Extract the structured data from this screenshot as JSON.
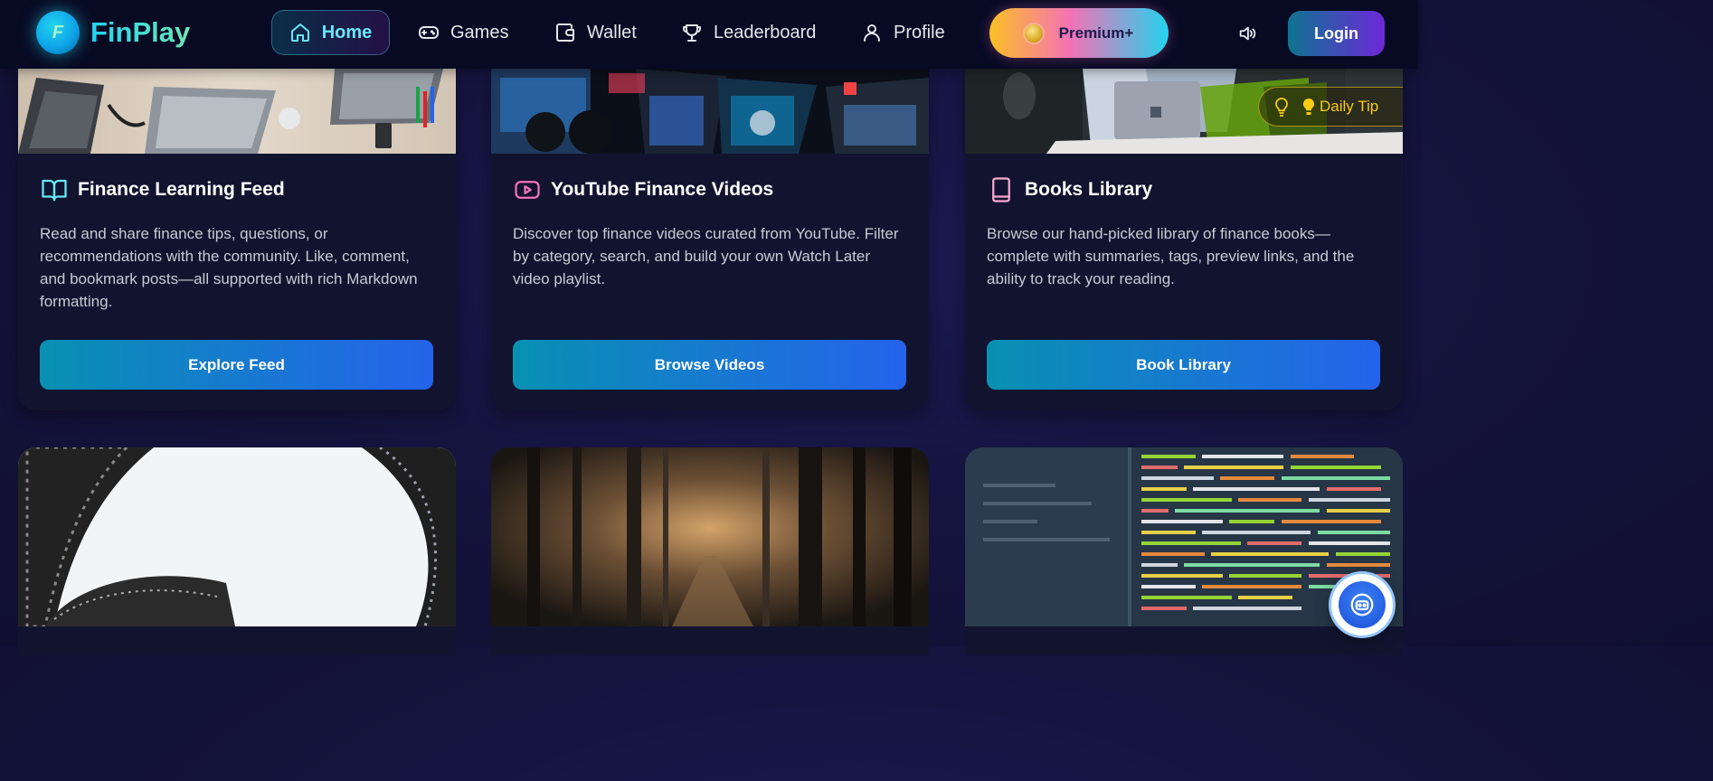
{
  "brand": {
    "name": "FinPlay",
    "logo_letter": "F"
  },
  "nav": {
    "items": [
      {
        "label": "Home",
        "icon": "home-icon",
        "active": true
      },
      {
        "label": "Games",
        "icon": "gamepad-icon"
      },
      {
        "label": "Wallet",
        "icon": "wallet-icon"
      },
      {
        "label": "Leaderboard",
        "icon": "trophy-icon"
      },
      {
        "label": "Profile",
        "icon": "user-icon"
      }
    ],
    "premium_label": "Premium+",
    "login_label": "Login",
    "sound_icon": "speaker-icon"
  },
  "daily_tip": {
    "label": "Daily Tip",
    "icon": "lightbulb-icon"
  },
  "cards": [
    {
      "title": "Finance Learning Feed",
      "icon": "open-book-icon",
      "description": "Read and share finance tips, questions, or recommendations with the community. Like, comment, and bookmark posts—all supported with rich Markdown formatting.",
      "button": "Explore Feed"
    },
    {
      "title": "YouTube Finance Videos",
      "icon": "video-play-icon",
      "description": "Discover top finance videos curated from YouTube. Filter by category, search, and build your own Watch Later video playlist.",
      "button": "Browse Videos"
    },
    {
      "title": "Books Library",
      "icon": "book-icon",
      "description": "Browse our hand-picked library of finance books—complete with summaries, tags, preview links, and the ability to track your reading.",
      "button": "Book Library"
    }
  ],
  "colors": {
    "accent_cyan": "#67e8f9",
    "button_gradient_start": "#0891b2",
    "button_gradient_end": "#2563eb",
    "tip_yellow": "#facc15",
    "card_bg": "#12142f"
  },
  "chat_widget": {
    "icon": "robot-icon"
  }
}
